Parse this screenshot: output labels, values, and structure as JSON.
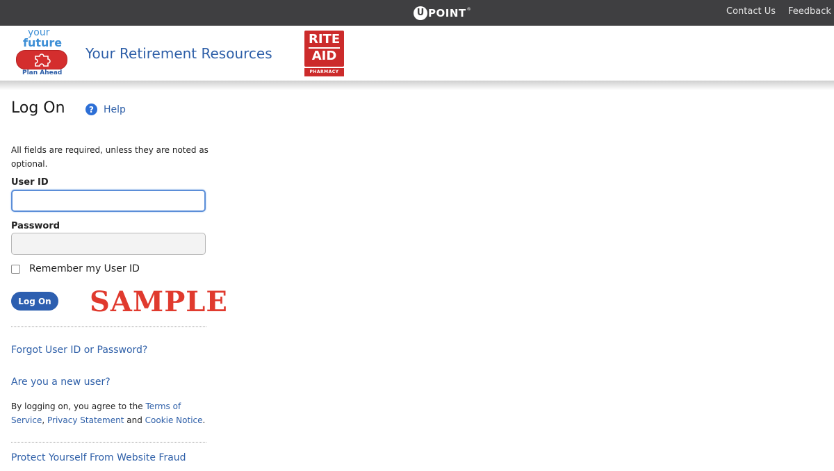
{
  "topbar": {
    "brand_letter": "U",
    "brand_word": "POINT",
    "brand_mark": "®",
    "contact_label": "Contact Us",
    "feedback_label": "Feedback"
  },
  "header": {
    "logo_your": "your",
    "logo_future": "future",
    "logo_plan": "Plan Ahead",
    "site_title": "Your Retirement Resources",
    "sponsor_line1": "RITE",
    "sponsor_line2": "AID",
    "sponsor_line3": "PHARMACY"
  },
  "main": {
    "title": "Log On",
    "help_label": "Help",
    "instructions": "All fields are required, unless they are noted as optional.",
    "user_id_label": "User ID",
    "user_id_value": "",
    "password_label": "Password",
    "password_value": "",
    "remember_label": "Remember my User ID",
    "remember_checked": false,
    "logon_button": "Log On",
    "watermark": "SAMPLE",
    "forgot_link": "Forgot User ID or Password?",
    "new_user_link": "Are you a new user?",
    "agree_prefix": "By logging on, you agree to the ",
    "terms_link": "Terms of Service",
    "agree_sep": ", ",
    "privacy_link": "Privacy Statement",
    "agree_and": " and ",
    "cookie_link": "Cookie Notice",
    "agree_end": ".",
    "fraud_link": "Protect Yourself From Website Fraud"
  },
  "colors": {
    "topbar_bg": "#3f3f41",
    "link_blue": "#2e5fa8",
    "button_blue": "#2d5fb0",
    "rite_aid_red": "#cc2b2b",
    "sample_red": "#e03a2e"
  },
  "icons": {
    "help": "question-circle-icon",
    "puzzle": "puzzle-icon"
  }
}
